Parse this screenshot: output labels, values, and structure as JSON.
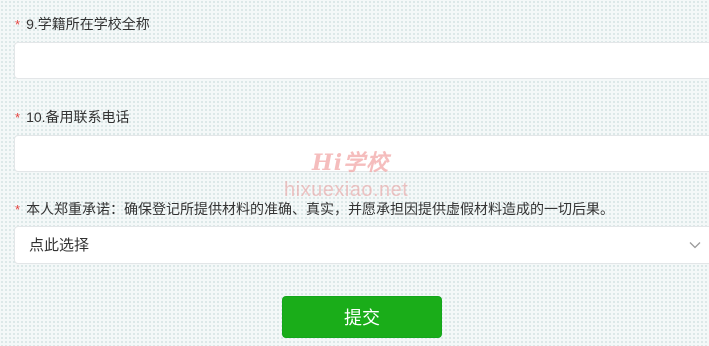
{
  "form": {
    "school": {
      "label": "9.学籍所在学校全称",
      "value": "",
      "placeholder": ""
    },
    "phone": {
      "label": "10.备用联系电话",
      "value": "",
      "placeholder": ""
    },
    "pledge": {
      "label": "本人郑重承诺：确保登记所提供材料的准确、真实，并愿承担因提供虚假材料造成的一切后果。",
      "selected": "点此选择"
    },
    "required_mark": "*",
    "submit_label": "提交"
  },
  "watermark": {
    "logo": "Hi学校",
    "url": "hixuexiao.net"
  },
  "colors": {
    "accent": "#1aad19",
    "required": "#e64340",
    "border": "#e3e6e8"
  },
  "icons": {
    "select_arrow": "chevron-down-icon"
  }
}
